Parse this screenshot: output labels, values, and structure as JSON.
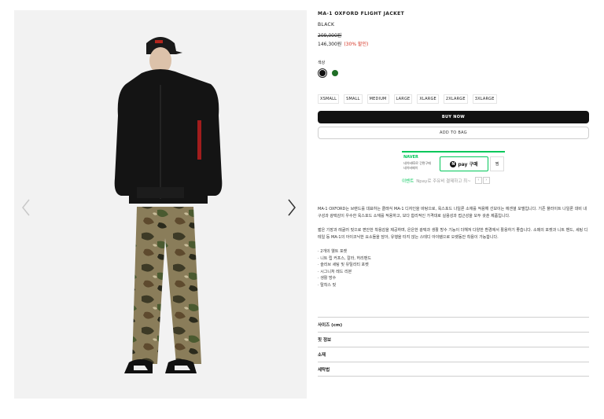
{
  "product": {
    "title": "MA-1 OXFORD FLIGHT JACKET",
    "color_name": "BLACK",
    "original_price": "209,000원",
    "sale_price": "146,300원",
    "discount": "(30% 할인)",
    "color_label": "색상",
    "swatches": [
      {
        "name": "black",
        "color": "#111111",
        "selected": true
      },
      {
        "name": "green",
        "color": "#1f6e26",
        "selected": false
      }
    ],
    "sizes": [
      "XSMALL",
      "SMALL",
      "MEDIUM",
      "LARGE",
      "XLARGE",
      "2XLARGE",
      "3XLARGE"
    ]
  },
  "actions": {
    "buy_now": "BUY NOW",
    "add_to_bag": "ADD TO BAG"
  },
  "naver": {
    "logo": "NAVER",
    "line1": "네이버ID로 간편구매",
    "line2": "네이버페이",
    "pay_label": "pay 구매",
    "pay_logo": "N",
    "wish_label": "찜",
    "event_label": "이벤트",
    "event_text": "Npay로 주유비 결제하고 최~"
  },
  "description": {
    "para1": "MA-1 OXFORD는 브랜드를 대표하는 클래식 MA-1 디자인을 바탕으로, 옥스포드 나일론 소재를 적용해 선보이는 에센셜 모델입니다. 기존 플라이트 나일론 대비 내구성과 광택감이 우수한 옥스포드 소재를 적용하고, 보다 합리적인 가격대로 실용성과 접근성을 모두 갖춘 제품입니다.",
    "para2": "짧은 기장과 레귤러 핏으로 편안한 착용감을 제공하며, 은은한 광택과 생활 방수 기능이 더해져 다양한 환경에서 활용하기 좋습니다. 소매의 포켓과 니트 밴드, 세팅 디테일 등 MA-1의 아이코닉한 요소들을 담아, 유행을 타지 않는 스테디 아이템으로 오랫동안 착용이 가능합니다.",
    "features": [
      "2개의 웰트 포켓",
      "니트 립 커프스, 칼라, 허리밴드",
      "슬리브 세팅 및 유틸리티 포켓",
      "시그니처 레드 리본",
      "생활 방수",
      "탈착스 핏"
    ]
  },
  "accordion": [
    "사이즈 (cm)",
    "핏 정보",
    "소재",
    "세탁법"
  ]
}
